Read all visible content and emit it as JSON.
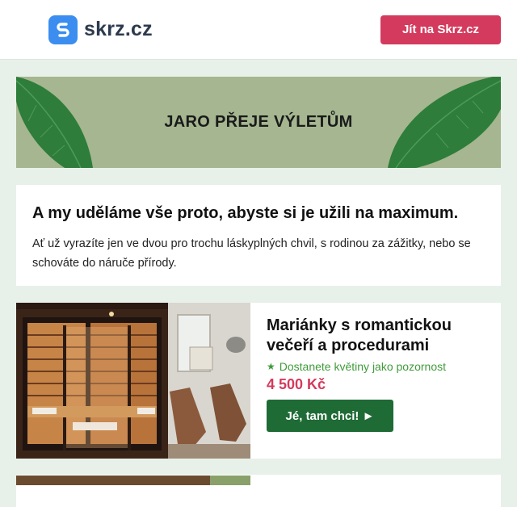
{
  "header": {
    "brand_name": "skrz.cz",
    "logo_icon": "skrz-s-logo-icon",
    "cta_label": "Jít na Skrz.cz"
  },
  "banner": {
    "title": "JARO PŘEJE VÝLETŮM",
    "background": "#a5b690",
    "leaf_color": "#2e7d3a"
  },
  "intro": {
    "heading": "A my uděláme vše proto, abyste si je užili na maximum.",
    "text": "Ať už vyrazíte jen ve dvou pro trochu láskyplných chvil, s rodinou za zážitky, nebo se schováte do náruče přírody."
  },
  "offers": [
    {
      "title": "Mariánky s romantickou večeří a procedurami",
      "perk": "Dostanete květiny jako pozornost",
      "perk_icon": "star-icon",
      "price": "4 500 Kč",
      "cta_label": "Jé, tam chci! ►",
      "photo": "infrared-sauna-and-lounge-chairs"
    }
  ],
  "colors": {
    "accent_red": "#d43a5d",
    "accent_green": "#1f6b36",
    "perk_green": "#3f9b3a",
    "page_bg": "#e8f0ea"
  }
}
